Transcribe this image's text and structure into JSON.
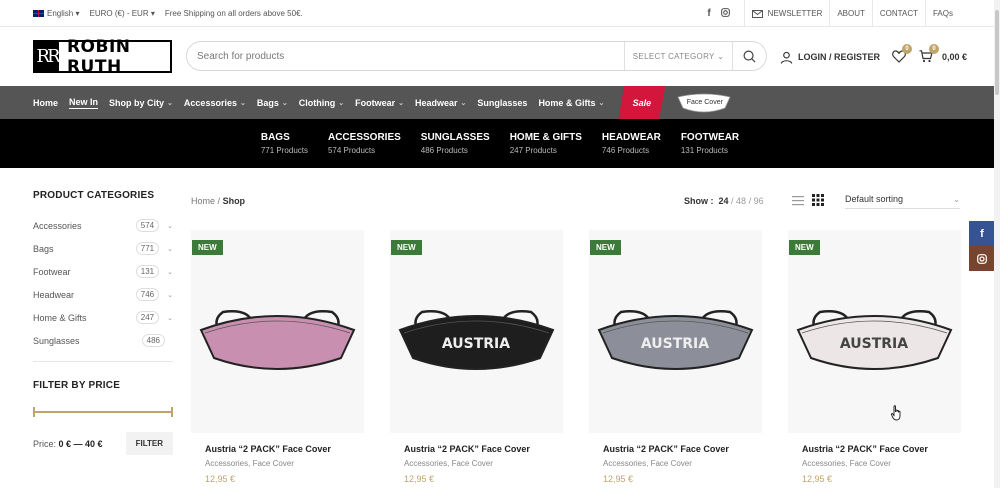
{
  "topbar": {
    "language": "English",
    "currency": "EURO (€) - EUR",
    "shipping": "Free Shipping on all orders above 50€.",
    "links": [
      "NEWSLETTER",
      "ABOUT",
      "CONTACT",
      "FAQs"
    ]
  },
  "header": {
    "logo_mark": "RR",
    "logo_text": "ROBIN RUTH",
    "search_placeholder": "Search for products",
    "search_category": "SELECT CATEGORY",
    "login": "LOGIN / REGISTER",
    "wishlist_count": "0",
    "cart_count": "0",
    "cart_total": "0,00 €"
  },
  "nav": {
    "items": [
      "Home",
      "New In",
      "Shop by City",
      "Accessories",
      "Bags",
      "Clothing",
      "Footwear",
      "Headwear",
      "Sunglasses",
      "Home & Gifts"
    ],
    "sale": "Sale",
    "face_cover": "Face Cover"
  },
  "catbar": [
    {
      "name": "BAGS",
      "count": "771 Products"
    },
    {
      "name": "ACCESSORIES",
      "count": "574 Products"
    },
    {
      "name": "SUNGLASSES",
      "count": "486 Products"
    },
    {
      "name": "HOME & GIFTS",
      "count": "247 Products"
    },
    {
      "name": "HEADWEAR",
      "count": "746 Products"
    },
    {
      "name": "FOOTWEAR",
      "count": "131 Products"
    }
  ],
  "sidebar": {
    "title": "PRODUCT CATEGORIES",
    "categories": [
      {
        "name": "Accessories",
        "count": "574"
      },
      {
        "name": "Bags",
        "count": "771"
      },
      {
        "name": "Footwear",
        "count": "131"
      },
      {
        "name": "Headwear",
        "count": "746"
      },
      {
        "name": "Home & Gifts",
        "count": "247"
      },
      {
        "name": "Sunglasses",
        "count": "486"
      }
    ],
    "filter_title": "FILTER BY PRICE",
    "price_label": "Price:",
    "price_range": "0 € — 40 €",
    "filter_button": "FILTER"
  },
  "shop": {
    "breadcrumb_home": "Home",
    "breadcrumb_sep": "/",
    "breadcrumb_current": "Shop",
    "show_label": "Show :",
    "show_options": [
      "24",
      "48",
      "96"
    ],
    "sorting": "Default sorting"
  },
  "products": [
    {
      "badge": "NEW",
      "title": "Austria “2 PACK” Face Cover",
      "cats": "Accessories, Face Cover",
      "price": "12,95 €",
      "mask_color": "#c98fb0",
      "mask_text": ""
    },
    {
      "badge": "NEW",
      "title": "Austria “2 PACK” Face Cover",
      "cats": "Accessories, Face Cover",
      "price": "12,95 €",
      "mask_color": "#1e1e1e",
      "mask_text": "AUSTRIA"
    },
    {
      "badge": "NEW",
      "title": "Austria “2 PACK” Face Cover",
      "cats": "Accessories, Face Cover",
      "price": "12,95 €",
      "mask_color": "#8c8f99",
      "mask_text": "AUSTRIA"
    },
    {
      "badge": "NEW",
      "title": "Austria “2 PACK” Face Cover",
      "cats": "Accessories, Face Cover",
      "price": "12,95 €",
      "mask_color": "#ece6e6",
      "mask_text": "AUSTRIA"
    }
  ],
  "colors": {
    "accent": "#bfa46b",
    "sale": "#d3163c",
    "new_badge": "#3c7a3a",
    "nav_bg": "#555555",
    "catbar_bg": "#000000"
  }
}
